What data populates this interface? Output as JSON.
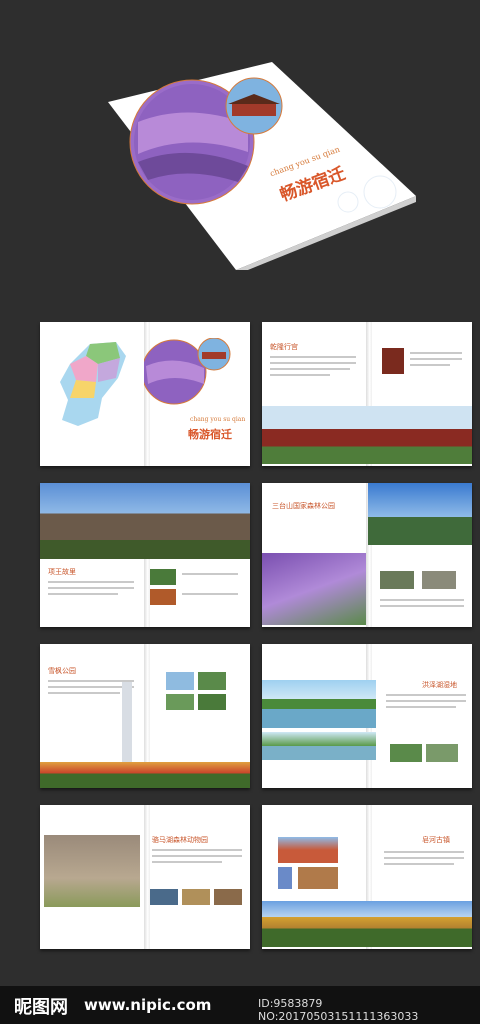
{
  "cover": {
    "pinyin": "chang you su qian",
    "title": "畅游宿迁"
  },
  "page2": {
    "pinyin": "chang you su qian",
    "title": "畅游宿迁"
  },
  "page3": {
    "title": "乾隆行宫"
  },
  "page4": {
    "title": "项王故里"
  },
  "page5": {
    "title": "三台山国家森林公园"
  },
  "page6": {
    "title": "雪枫公园"
  },
  "page7": {
    "title": "洪泽湖湿地"
  },
  "page8": {
    "title": "骆马湖森林动物园"
  },
  "page9": {
    "title": "皂河古镇"
  },
  "watermark": {
    "logo": "昵图网",
    "site": "www.nipic.com",
    "id": "ID:9583879 NO:20170503151111363033"
  }
}
